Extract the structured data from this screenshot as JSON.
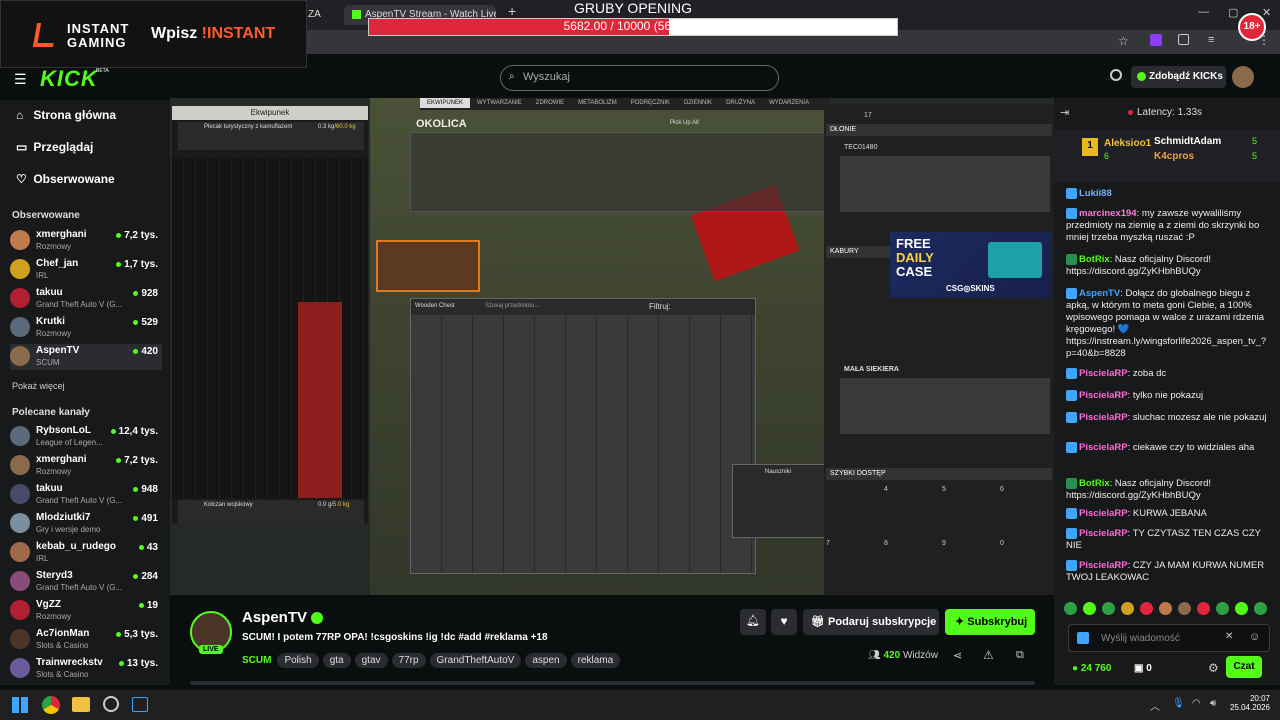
{
  "browser": {
    "tabs": [
      {
        "label": "ZA"
      },
      {
        "label": "AspenTV Stream - Watch Live o"
      }
    ],
    "new_tab": "+",
    "window_controls": [
      "—",
      "▢",
      "✕"
    ],
    "badge": "18+"
  },
  "promo": {
    "brand_line1": "INSTANT",
    "brand_line2": "GAMING",
    "text_prefix": "Wpisz ",
    "code": "!INSTANT"
  },
  "goal": {
    "title": "GRUBY OPENING",
    "text": "5682.00 / 10000 (56.82%)",
    "progress": 0.5682
  },
  "header": {
    "logo": "KICK",
    "logo_beta": "BETA",
    "search_placeholder": "Wyszukaj",
    "get_kicks": "Zdobądź KICKs"
  },
  "sidebar": {
    "nav": [
      {
        "label": "Strona główna",
        "icon": "home-icon"
      },
      {
        "label": "Przeglądaj",
        "icon": "browse-icon"
      },
      {
        "label": "Obserwowane",
        "icon": "heart-icon"
      }
    ],
    "followed_title": "Obserwowane",
    "followed": [
      {
        "name": "xmerghani",
        "game": "Rozmowy",
        "viewers": "7,2 tys."
      },
      {
        "name": "Chef_jan",
        "game": "IRL",
        "viewers": "1,7 tys."
      },
      {
        "name": "takuu",
        "game": "Grand Theft Auto V (G...",
        "viewers": "928"
      },
      {
        "name": "Krutki",
        "game": "Rozmowy",
        "viewers": "529"
      },
      {
        "name": "AspenTV",
        "game": "SCUM",
        "viewers": "420"
      }
    ],
    "show_more": "Pokaż więcej",
    "recommended_title": "Polecane kanały",
    "recommended": [
      {
        "name": "RybsonLoL",
        "game": "League of Legen...",
        "viewers": "12,4 tys."
      },
      {
        "name": "xmerghani",
        "game": "Rozmowy",
        "viewers": "7,2 tys."
      },
      {
        "name": "takuu",
        "game": "Grand Theft Auto V (G...",
        "viewers": "948"
      },
      {
        "name": "Mlodziutki7",
        "game": "Gry i wersje demo",
        "viewers": "491"
      },
      {
        "name": "kebab_u_rudego",
        "game": "IRL",
        "viewers": "43"
      },
      {
        "name": "Steryd3",
        "game": "Grand Theft Auto V (G...",
        "viewers": "284"
      },
      {
        "name": "VgZZ",
        "game": "Rozmowy",
        "viewers": "19"
      },
      {
        "name": "Ac7ionMan",
        "game": "Slots & Casino",
        "viewers": "5,3 tys."
      },
      {
        "name": "Trainwreckstv",
        "game": "Slots & Casino",
        "viewers": "13 tys."
      }
    ]
  },
  "game": {
    "left_title": "Ekwipunek",
    "backpack": "Plecak turystyczny z kamuflażem",
    "backpack_weight": "0.3 kg/",
    "backpack_max": "60.0 kg",
    "belt": "Kołczan wojskowy",
    "belt_weight": "0.0 g/",
    "belt_max": "5.0 kg",
    "tabs": [
      "EKWIPUNEK",
      "WYTWARZANIE",
      "ZDROWIE",
      "METABOLIZM",
      "PODRĘCZNIK",
      "DZIENNIK",
      "DRUŻYNA",
      "WYDARZENIA"
    ],
    "area_title": "OKOLICA",
    "pickup_all": "Pick Up All",
    "filter": "Filtruj:",
    "wooden_chest": "Wooden Chest",
    "search_items": "Szukaj przedmiotu...",
    "tooltip_title": "Nauszniki",
    "right_hands": "DŁONIE",
    "right_slot1": "TEC01480",
    "right_holsters": "KABURY",
    "right_axe": "MAŁA SIEKIERA",
    "quick_access": "SZYBKI DOSTĘP",
    "quick_numbers": [
      "4",
      "5",
      "6",
      "7",
      "8",
      "9",
      "0"
    ],
    "count": "17",
    "ad_line1": "FREE",
    "ad_line2": "DAILY",
    "ad_line3": "CASE",
    "ad_brand": "CSG◎SKINS"
  },
  "channel": {
    "name": "AspenTV",
    "live": "LIVE",
    "title": "SCUM! I potem 77RP OPA! !csgoskins !ig !dc #add #reklama +18",
    "category": "SCUM",
    "tags": [
      "Polish",
      "gta",
      "gtav",
      "77rp",
      "GrandTheftAutoV",
      "aspen",
      "reklama"
    ],
    "gift_button": "Podaruj subskrypcje",
    "subscribe_button": "Subskrybuj",
    "viewers": "420",
    "viewers_label": "Widzów"
  },
  "chat": {
    "latency": "Latency: 1.33s",
    "top": [
      {
        "rank": "1",
        "name": "Aleksioo1",
        "count": "6"
      },
      {
        "name": "SchmidtAdam",
        "count": "5"
      },
      {
        "name": "K4cpros",
        "count": "5"
      }
    ],
    "messages": [
      {
        "user": "Lukii88",
        "color": "#6fb3ff",
        "text": ""
      },
      {
        "user": "marcinex194",
        "color": "#ff7ad9",
        "text": "my zawsze wywaliliśmy przedmioty na ziemię a z ziemi do skrzynki bo mniej trzeba myszką ruszać :P"
      },
      {
        "user": "BotRix",
        "color": "#53fc18",
        "text": "Nasz oficjalny Discord! https://discord.gg/ZyKHbhBUQy"
      },
      {
        "user": "AspenTV",
        "color": "#3ea6ff",
        "text": "Dołącz do globalnego biegu z apką, w którym to meta goni Ciebie, a 100% wpisowego pomaga w walce z urazami rdzenia kręgowego! 💙 https://instream.ly/wingsforlife2026_aspen_tv_?p=40&b=8828"
      },
      {
        "user": "PiscielaRP",
        "color": "#ff6ad5",
        "text": "zoba dc"
      },
      {
        "user": "PiscielaRP",
        "color": "#ff6ad5",
        "text": "tylko nie pokazuj"
      },
      {
        "user": "PiscielaRP",
        "color": "#ff6ad5",
        "text": "sluchac mozesz ale nie pokazuj"
      },
      {
        "user": "PiscielaRP",
        "color": "#ff6ad5",
        "text": "ciekawe czy to widziales aha"
      },
      {
        "user": "BotRix",
        "color": "#53fc18",
        "text": "Nasz oficjalny Discord! https://discord.gg/ZyKHbhBUQy"
      },
      {
        "user": "PiscielaRP",
        "color": "#ff6ad5",
        "text": "KURWA JEBANA"
      },
      {
        "user": "PiscielaRP",
        "color": "#ff6ad5",
        "text": "TY CZYTASZ TEN CZAS CZY NIE"
      },
      {
        "user": "PiscielaRP",
        "color": "#ff6ad5",
        "text": "CZY JA MAM KURWA NUMER TWOJ LEAKOWAC"
      }
    ],
    "input_placeholder": "Wyślij wiadomość",
    "kicks": "24 760",
    "gifts": "0",
    "send_button": "Czat"
  },
  "taskbar": {
    "time": "20:07",
    "date": "25.04.2026"
  },
  "colors": {
    "accent": "#53fc18",
    "background": "#0b0e0f",
    "panel": "#18191b",
    "goal": "#e0263a"
  }
}
